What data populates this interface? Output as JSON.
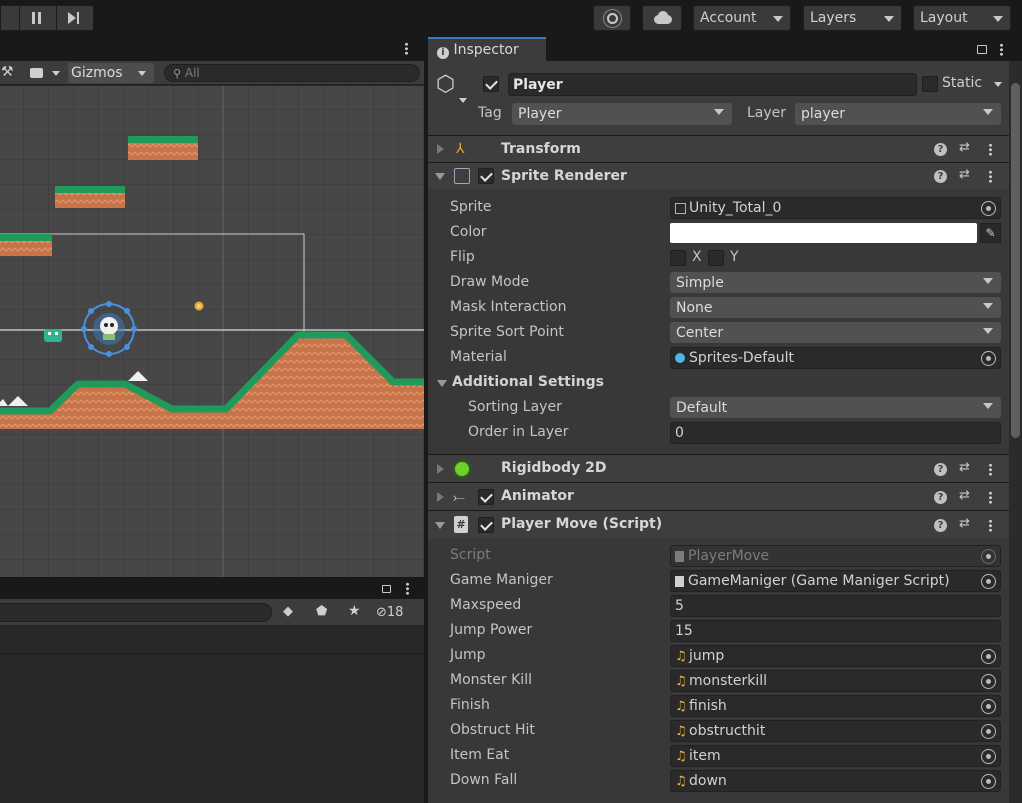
{
  "toolbar": {
    "account_label": "Account",
    "layers_label": "Layers",
    "layout_label": "Layout"
  },
  "scene": {
    "gizmos_label": "Gizmos",
    "search_placeholder": "All"
  },
  "project": {
    "hidden_count": "18"
  },
  "inspector": {
    "tab_label": "Inspector",
    "object_name": "Player",
    "static_label": "Static",
    "tag_label": "Tag",
    "tag_value": "Player",
    "layer_label": "Layer",
    "layer_value": "player"
  },
  "components": {
    "transform": "Transform",
    "sprite_renderer": "Sprite Renderer",
    "rigidbody": "Rigidbody 2D",
    "animator": "Animator",
    "player_move": "Player Move (Script)"
  },
  "sprite_renderer": {
    "sprite_label": "Sprite",
    "sprite_value": "Unity_Total_0",
    "color_label": "Color",
    "color_value": "#ffffff",
    "flip_label": "Flip",
    "flip_x": "X",
    "flip_y": "Y",
    "draw_mode_label": "Draw Mode",
    "draw_mode_value": "Simple",
    "mask_label": "Mask Interaction",
    "mask_value": "None",
    "sort_point_label": "Sprite Sort Point",
    "sort_point_value": "Center",
    "material_label": "Material",
    "material_value": "Sprites-Default",
    "additional_label": "Additional Settings",
    "sorting_layer_label": "Sorting Layer",
    "sorting_layer_value": "Default",
    "order_label": "Order in Layer",
    "order_value": "0"
  },
  "player_move": {
    "script_label": "Script",
    "script_value": "PlayerMove",
    "game_manager_label": "Game Maniger",
    "game_manager_value": "GameManiger (Game Maniger Script)",
    "maxspeed_label": "Maxspeed",
    "maxspeed_value": "5",
    "jump_power_label": "Jump Power",
    "jump_power_value": "15",
    "jump_label": "Jump",
    "jump_value": "jump",
    "monster_kill_label": "Monster Kill",
    "monster_kill_value": "monsterkill",
    "finish_label": "Finish",
    "finish_value": "finish",
    "obstruct_label": "Obstruct Hit",
    "obstruct_value": "obstructhit",
    "item_label": "Item Eat",
    "item_value": "item",
    "down_label": "Down Fall",
    "down_value": "down"
  },
  "colors": {
    "grass": "#1f9a5a",
    "dirt": "#c8744a",
    "selection": "#4a90e2"
  }
}
